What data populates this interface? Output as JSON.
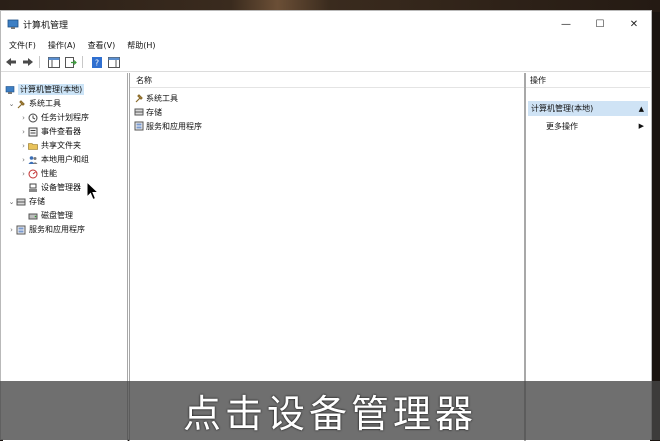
{
  "window": {
    "title": "计算机管理",
    "controls": {
      "minimize": "—",
      "maximize": "☐",
      "close": "✕"
    }
  },
  "menu": [
    "文件(F)",
    "操作(A)",
    "查看(V)",
    "帮助(H)"
  ],
  "tree": {
    "root": "计算机管理(本地)",
    "system_tools": "系统工具",
    "task_scheduler": "任务计划程序",
    "event_viewer": "事件查看器",
    "shared_folders": "共享文件夹",
    "local_users": "本地用户和组",
    "performance": "性能",
    "device_manager": "设备管理器",
    "storage": "存储",
    "disk_management": "磁盘管理",
    "services_apps": "服务和应用程序"
  },
  "list": {
    "column_name": "名称",
    "items": [
      "系统工具",
      "存储",
      "服务和应用程序"
    ]
  },
  "actions": {
    "header": "操作",
    "section": "计算机管理(本地)",
    "more": "更多操作"
  },
  "subtitle": "点击设备管理器",
  "colors": {
    "selection": "#cce4f7",
    "actions_section": "#cfe3f5",
    "subtitle_band": "#464646"
  }
}
